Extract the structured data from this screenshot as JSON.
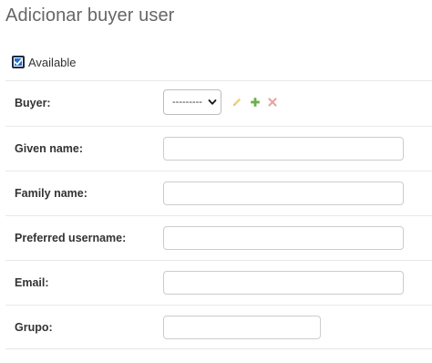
{
  "page": {
    "title": "Adicionar buyer user"
  },
  "available": {
    "label": "Available",
    "checked": true
  },
  "buyer": {
    "label": "Buyer:",
    "selected": "---------"
  },
  "fields": {
    "given_name": {
      "label": "Given name:",
      "value": ""
    },
    "family_name": {
      "label": "Family name:",
      "value": ""
    },
    "preferred_username": {
      "label": "Preferred username:",
      "value": ""
    },
    "email": {
      "label": "Email:",
      "value": ""
    },
    "grupo": {
      "label": "Grupo:",
      "value": ""
    }
  },
  "icons": {
    "edit": "pencil-icon",
    "add": "plus-icon",
    "delete": "x-icon",
    "select": "chevron-down-icon"
  },
  "colors": {
    "checkbox": "#1f6fd1",
    "edit_icon": "#f0d27a",
    "add_icon": "#6cb04a",
    "delete_icon": "#e9a3a3"
  }
}
